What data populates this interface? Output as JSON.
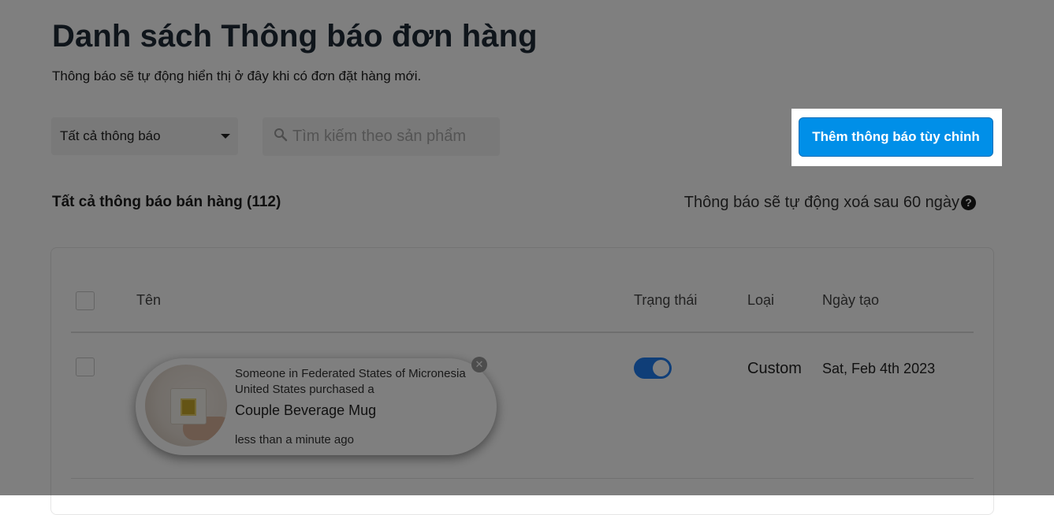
{
  "header": {
    "title": "Danh sách Thông báo đơn hàng",
    "subtitle": "Thông báo sẽ tự động hiển thị ở đây khi có đơn đặt hàng mới."
  },
  "filters": {
    "select_value": "Tất cả thông báo",
    "search_placeholder": "Tìm kiếm theo sản phẩm"
  },
  "actions": {
    "add_custom_label": "Thêm thông báo tùy chỉnh"
  },
  "list": {
    "section_title": "Tất cả thông báo bán hàng (112)",
    "auto_delete_note": "Thông báo sẽ tự động xoá sau 60 ngày",
    "columns": {
      "name": "Tên",
      "status": "Trạng thái",
      "type": "Loại",
      "created": "Ngày tạo"
    },
    "rows": [
      {
        "popup": {
          "line1": "Someone in Federated States of Micronesia",
          "line2": "United States purchased a",
          "product": "Couple Beverage Mug",
          "time": "less than a minute ago"
        },
        "status_on": true,
        "type": "Custom",
        "created": "Sat, Feb 4th 2023"
      }
    ]
  },
  "icons": {
    "help": "help-circle-icon",
    "search": "search-icon",
    "close": "close-icon",
    "caret": "chevron-down-icon"
  },
  "colors": {
    "primary_button": "#008fe8",
    "toggle_on": "#1e7cf0",
    "overlay": "rgba(0,0,0,0.5)"
  }
}
